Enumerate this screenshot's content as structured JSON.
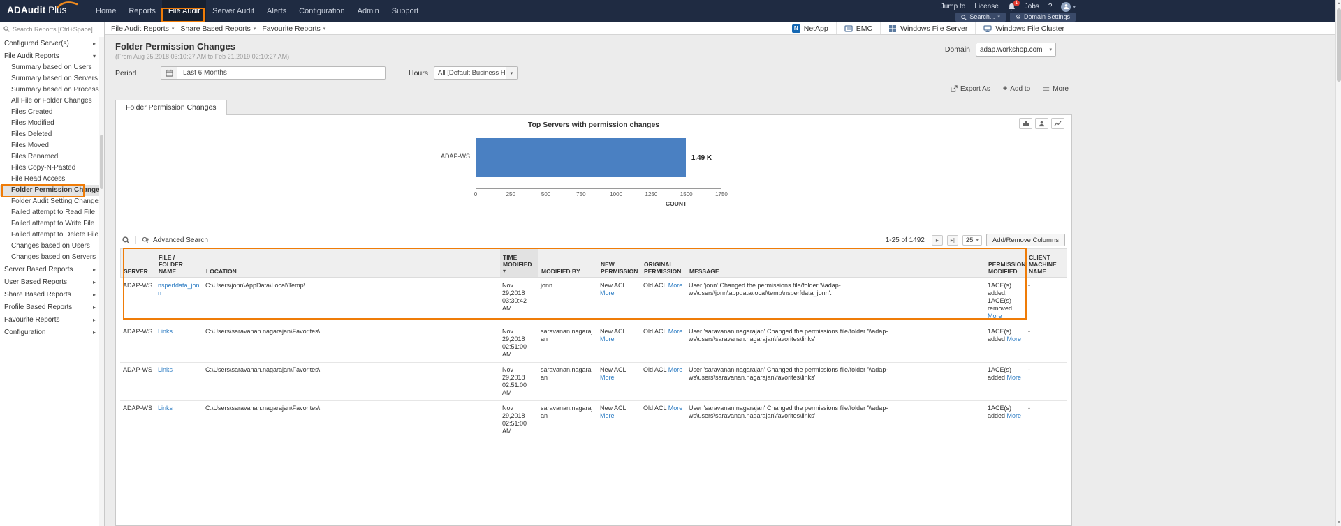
{
  "navbar": {
    "logo_primary": "ADAudit",
    "logo_secondary": " Plus",
    "items": [
      {
        "label": "Home"
      },
      {
        "label": "Reports"
      },
      {
        "label": "File Audit",
        "active": true
      },
      {
        "label": "Server Audit"
      },
      {
        "label": "Alerts"
      },
      {
        "label": "Configuration"
      },
      {
        "label": "Admin"
      },
      {
        "label": "Support"
      }
    ],
    "jump_to": "Jump to",
    "license": "License",
    "jobs": "Jobs",
    "help": "?",
    "bell_badge": "1",
    "search_button": "Search...",
    "domain_settings_button": "Domain Settings"
  },
  "toolbar": {
    "menus": [
      {
        "label": "File Audit Reports"
      },
      {
        "label": "Share Based Reports"
      },
      {
        "label": "Favourite Reports"
      }
    ],
    "storage_types": [
      {
        "label": "NetApp"
      },
      {
        "label": "EMC"
      },
      {
        "label": "Windows File Server"
      },
      {
        "label": "Windows File Cluster"
      }
    ]
  },
  "sidebar": {
    "search_placeholder": "Search Reports [Ctrl+Space]",
    "items": [
      {
        "label": "Configured Server(s)",
        "type": "group"
      },
      {
        "label": "File Audit Reports",
        "type": "group",
        "expanded": true
      },
      {
        "label": "Summary based on Users",
        "type": "child"
      },
      {
        "label": "Summary based on Servers",
        "type": "child"
      },
      {
        "label": "Summary based on Process",
        "type": "child"
      },
      {
        "label": "All File or Folder Changes",
        "type": "child"
      },
      {
        "label": "Files Created",
        "type": "child"
      },
      {
        "label": "Files Modified",
        "type": "child"
      },
      {
        "label": "Files Deleted",
        "type": "child"
      },
      {
        "label": "Files Moved",
        "type": "child"
      },
      {
        "label": "Files Renamed",
        "type": "child"
      },
      {
        "label": "Files Copy-N-Pasted",
        "type": "child"
      },
      {
        "label": "File Read Access",
        "type": "child"
      },
      {
        "label": "Folder Permission Changes",
        "type": "child",
        "selected": true
      },
      {
        "label": "Folder Audit Setting Changes(SACL)",
        "type": "child"
      },
      {
        "label": "Failed attempt to Read File",
        "type": "child"
      },
      {
        "label": "Failed attempt to Write File",
        "type": "child"
      },
      {
        "label": "Failed attempt to Delete File",
        "type": "child"
      },
      {
        "label": "Changes based on Users",
        "type": "child"
      },
      {
        "label": "Changes based on Servers",
        "type": "child"
      },
      {
        "label": "Server Based Reports",
        "type": "group"
      },
      {
        "label": "User Based Reports",
        "type": "group"
      },
      {
        "label": "Share Based Reports",
        "type": "group"
      },
      {
        "label": "Profile Based Reports",
        "type": "group"
      },
      {
        "label": "Favourite Reports",
        "type": "group"
      },
      {
        "label": "Configuration",
        "type": "group"
      }
    ]
  },
  "page": {
    "title": "Folder Permission Changes",
    "subtitle": "(From Aug 25,2018 03:10:27 AM to Feb 21,2019 02:10:27 AM)",
    "domain_label": "Domain",
    "domain_value": "adap.workshop.com",
    "period_label": "Period",
    "period_value": "Last 6 Months",
    "hours_label": "Hours",
    "hours_value": "All [Default Business Hour]",
    "export_as": "Export As",
    "add_to": "Add to",
    "more": "More",
    "tab": "Folder Permission Changes"
  },
  "chart_data": {
    "type": "bar",
    "orientation": "horizontal",
    "title": "Top Servers with permission changes",
    "categories": [
      "ADAP-WS"
    ],
    "values": [
      1490
    ],
    "value_labels": [
      "1.49 K"
    ],
    "xlabel": "COUNT",
    "xticks": [
      "0",
      "250",
      "500",
      "750",
      "1000",
      "1250",
      "1500",
      "1750"
    ],
    "xlim": [
      0,
      1750
    ],
    "bar_color": "#4a80c2",
    "grid": false,
    "legend": false
  },
  "table": {
    "advanced_search": "Advanced Search",
    "pagination": "1-25 of 1492",
    "page_size": "25",
    "add_remove_columns": "Add/Remove Columns",
    "more_label": "More",
    "columns": [
      {
        "label": "SERVER"
      },
      {
        "label": "FILE / FOLDER NAME"
      },
      {
        "label": "LOCATION"
      },
      {
        "label": "TIME MODIFIED",
        "sorted": true
      },
      {
        "label": "MODIFIED BY"
      },
      {
        "label": "NEW PERMISSION"
      },
      {
        "label": "ORIGINAL PERMISSION"
      },
      {
        "label": "MESSAGE"
      },
      {
        "label": "PERMISSION MODIFIED"
      },
      {
        "label": "CLIENT MACHINE NAME"
      }
    ],
    "rows": [
      {
        "server": "ADAP-WS",
        "file_name": "nsperfdata_jonn",
        "location": "C:\\Users\\jonn\\AppData\\Local\\Temp\\",
        "time_modified": "Nov 29,2018 03:30:42 AM",
        "modified_by": "jonn",
        "new_permission": "New ACL",
        "original_permission": "Old ACL",
        "message": "User 'jonn' Changed the permissions file/folder '\\\\adap-ws\\users\\jonn\\appdata\\local\\temp\\nsperfdata_jonn'.",
        "permission_modified": "1ACE(s) added, 1ACE(s) removed",
        "client_machine": "-"
      },
      {
        "server": "ADAP-WS",
        "file_name": "Links",
        "location": "C:\\Users\\saravanan.nagarajan\\Favorites\\",
        "time_modified": "Nov 29,2018 02:51:00 AM",
        "modified_by": "saravanan.nagarajan",
        "new_permission": "New ACL",
        "original_permission": "Old ACL",
        "message": "User 'saravanan.nagarajan' Changed the permissions file/folder '\\\\adap-ws\\users\\saravanan.nagarajan\\favorites\\links'.",
        "permission_modified": "1ACE(s) added",
        "client_machine": "-"
      },
      {
        "server": "ADAP-WS",
        "file_name": "Links",
        "location": "C:\\Users\\saravanan.nagarajan\\Favorites\\",
        "time_modified": "Nov 29,2018 02:51:00 AM",
        "modified_by": "saravanan.nagarajan",
        "new_permission": "New ACL",
        "original_permission": "Old ACL",
        "message": "User 'saravanan.nagarajan' Changed the permissions file/folder '\\\\adap-ws\\users\\saravanan.nagarajan\\favorites\\links'.",
        "permission_modified": "1ACE(s) added",
        "client_machine": "-"
      },
      {
        "server": "ADAP-WS",
        "file_name": "Links",
        "location": "C:\\Users\\saravanan.nagarajan\\Favorites\\",
        "time_modified": "Nov 29,2018 02:51:00 AM",
        "modified_by": "saravanan.nagarajan",
        "new_permission": "New ACL",
        "original_permission": "Old ACL",
        "message": "User 'saravanan.nagarajan' Changed the permissions file/folder '\\\\adap-ws\\users\\saravanan.nagarajan\\favorites\\links'.",
        "permission_modified": "1ACE(s) added",
        "client_machine": "-"
      }
    ]
  }
}
